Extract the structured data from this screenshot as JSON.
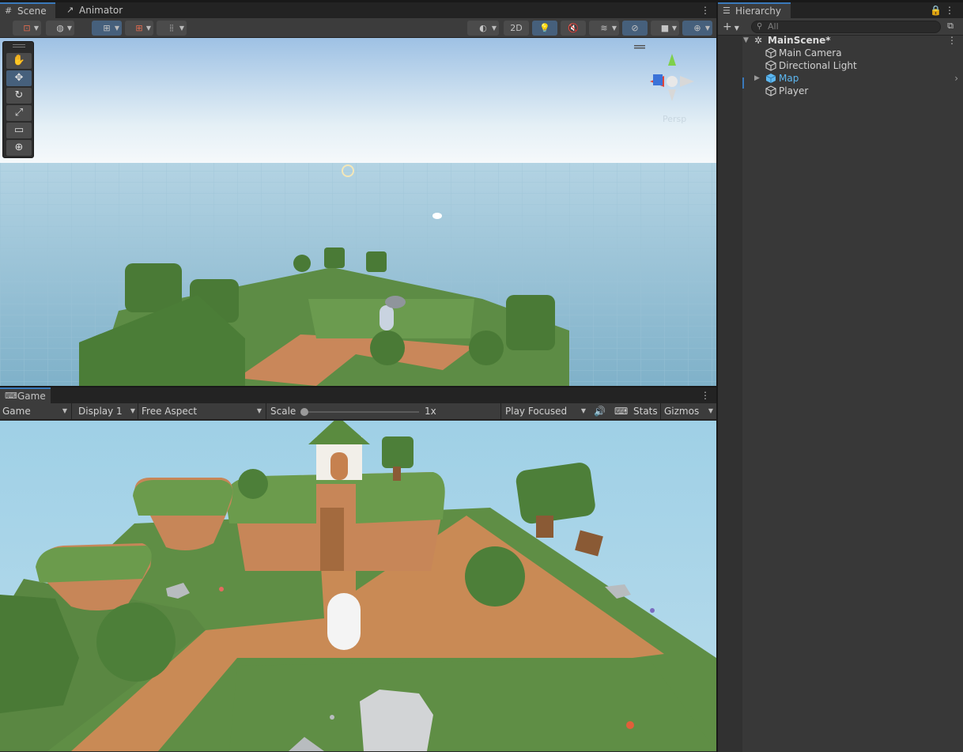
{
  "scene_panel": {
    "tabs": [
      {
        "label": "Scene",
        "icon": "hash-grid-icon"
      },
      {
        "label": "Animator",
        "icon": "animator-icon"
      }
    ],
    "toolbar": {
      "draw_mode_2d": "2D",
      "view_label": "Persp"
    },
    "tools": [
      "hand-tool-icon",
      "move-tool-icon",
      "rotate-tool-icon",
      "scale-tool-icon",
      "rect-tool-icon",
      "transform-tool-icon"
    ],
    "sky_color_top": "#a9c8e6",
    "ground_color": "#8fbcd3"
  },
  "game_panel": {
    "tab": {
      "label": "Game",
      "icon": "gamepad-icon"
    },
    "toolbar": {
      "mode": "Game",
      "display": "Display 1",
      "aspect": "Free Aspect",
      "scale_label": "Scale",
      "scale_value": "1x",
      "play_mode": "Play Focused",
      "stats": "Stats",
      "gizmos": "Gizmos"
    }
  },
  "hierarchy": {
    "tab": {
      "label": "Hierarchy",
      "icon": "list-icon"
    },
    "search_placeholder": "All",
    "scene_name": "MainScene*",
    "items": [
      {
        "label": "Main Camera",
        "selected": false
      },
      {
        "label": "Directional Light",
        "selected": false
      },
      {
        "label": "Map",
        "selected": true
      },
      {
        "label": "Player",
        "selected": false
      }
    ],
    "accent_color": "#5db7f0"
  }
}
